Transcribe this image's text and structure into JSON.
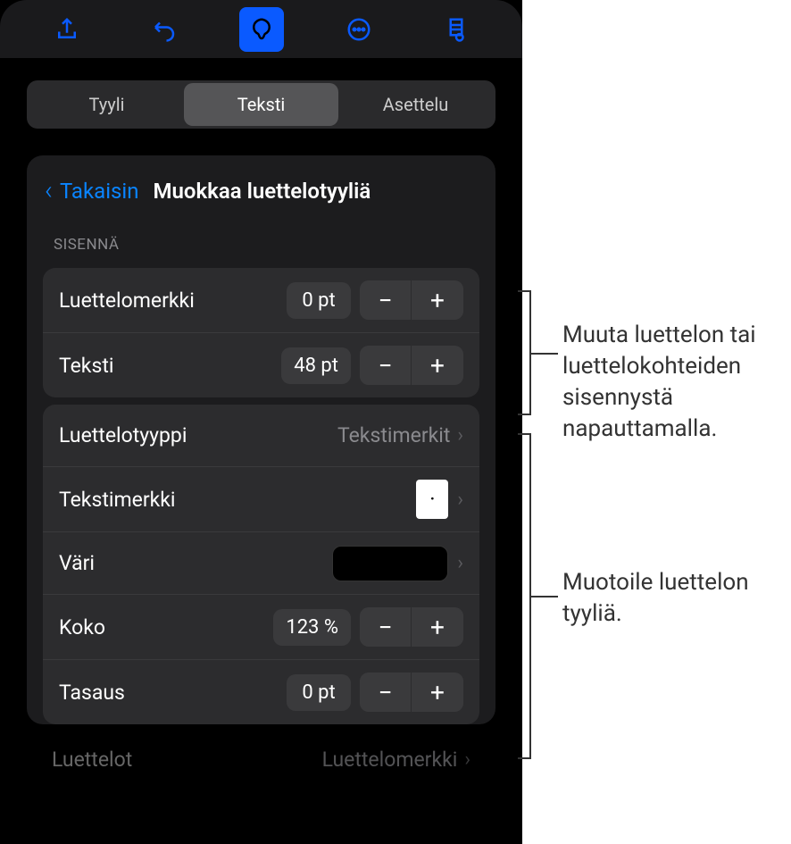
{
  "tabs": {
    "style": "Tyyli",
    "text": "Teksti",
    "layout": "Asettelu"
  },
  "header": {
    "back": "Takaisin",
    "title": "Muokkaa luettelotyyliä"
  },
  "indent": {
    "section_title": "SISENNÄ",
    "bullet_label": "Luettelomerkki",
    "bullet_value": "0 pt",
    "text_label": "Teksti",
    "text_value": "48 pt"
  },
  "format": {
    "bullet_type_label": "Luettelotyyppi",
    "bullet_type_value": "Tekstimerkit",
    "text_char_label": "Tekstimerkki",
    "text_char_value": "·",
    "color_label": "Väri",
    "color_value": "#000000",
    "size_label": "Koko",
    "size_value": "123 %",
    "align_label": "Tasaus",
    "align_value": "0 pt"
  },
  "footer": {
    "lists_label": "Luettelot",
    "lists_value": "Luettelomerkki"
  },
  "callouts": {
    "indent_callout": "Muuta luettelon tai luettelokohteiden sisennystä napauttamalla.",
    "format_callout": "Muotoile luettelon tyyliä."
  }
}
